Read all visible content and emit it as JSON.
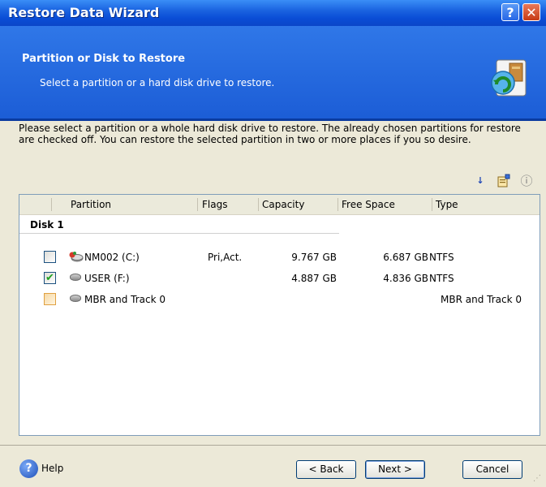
{
  "window": {
    "title": "Restore Data Wizard",
    "help_glyph": "?",
    "close_glyph": "✕"
  },
  "header": {
    "title": "Partition or Disk to Restore",
    "subtitle": "Select a partition or a hard disk drive to restore."
  },
  "description": "Please select a partition or a whole hard disk drive to restore. The already chosen partitions for restore are checked off. You can restore the selected partition in two or more places if you so desire.",
  "toolbar": {
    "icons": [
      "sort-icon",
      "properties-icon",
      "info-icon"
    ],
    "sort_glyph": "↓",
    "info_glyph": "ⓘ"
  },
  "columns": [
    "Partition",
    "Flags",
    "Capacity",
    "Free Space",
    "Type"
  ],
  "disk": {
    "label": "Disk 1"
  },
  "rows": [
    {
      "name": "NM002 (C:)",
      "flags": "Pri,Act.",
      "capacity": "9.767 GB",
      "free": "6.687 GB",
      "type": "NTFS",
      "checked": false,
      "check_style": "normal"
    },
    {
      "name": "USER (F:)",
      "flags": "",
      "capacity": "4.887 GB",
      "free": "4.836 GB",
      "type": "NTFS",
      "checked": true,
      "check_style": "normal",
      "check_glyph": "✔"
    },
    {
      "name": "MBR and Track 0",
      "flags": "",
      "capacity": "",
      "free": "",
      "type": "MBR and Track 0",
      "checked": false,
      "check_style": "orange"
    }
  ],
  "footer": {
    "help_label": "Help",
    "help_glyph": "?",
    "back_label": "< Back",
    "next_label": "Next >",
    "cancel_label": "Cancel"
  },
  "colors": {
    "title_bar": "#1a63e0",
    "banner": "#2f77e8",
    "window_bg": "#ECE9D8",
    "check_green": "#21a121"
  }
}
